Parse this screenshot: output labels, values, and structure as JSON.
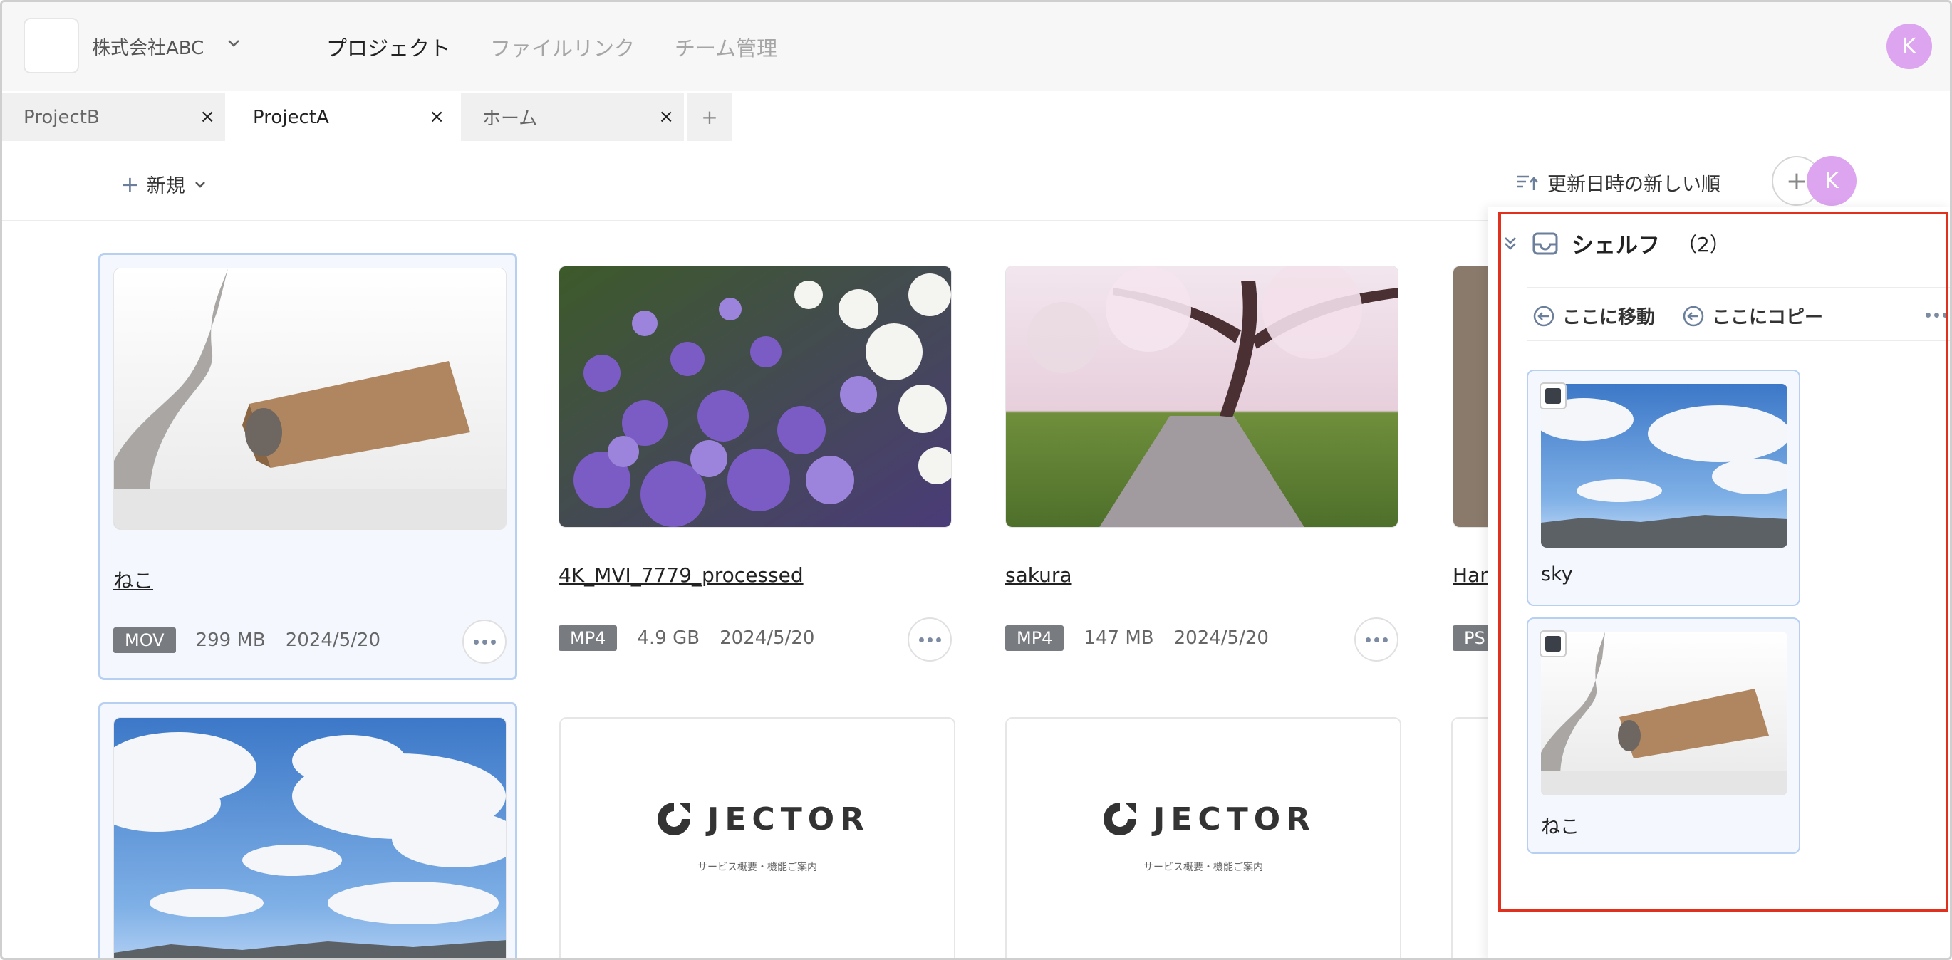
{
  "header": {
    "org_name": "株式会社ABC",
    "nav": [
      "プロジェクト",
      "ファイルリンク",
      "チーム管理"
    ],
    "avatar_initial": "K"
  },
  "tabs": [
    {
      "label": "ProjectB",
      "active": false
    },
    {
      "label": "ProjectA",
      "active": true
    },
    {
      "label": "ホーム",
      "active": false
    }
  ],
  "tab_close": "×",
  "tab_add": "+",
  "toolbar": {
    "new_label": "新規",
    "sort_label": "更新日時の新しい順",
    "add_symbol": "+",
    "avatar_initial": "K"
  },
  "files": [
    {
      "name": "ねこ",
      "type": "MOV",
      "size": "299 MB",
      "date": "2024/5/20",
      "selected": true
    },
    {
      "name": "4K_MVI_7779_processed",
      "type": "MP4",
      "size": "4.9 GB",
      "date": "2024/5/20",
      "selected": false
    },
    {
      "name": "sakura",
      "type": "MP4",
      "size": "147 MB",
      "date": "2024/5/20",
      "selected": false
    },
    {
      "name": "Han",
      "type": "PS",
      "size": "",
      "date": "",
      "selected": false
    }
  ],
  "docs": {
    "logo_text": "JECTOR",
    "subtitle": "サービス概要・機能ご案内"
  },
  "shelf": {
    "title": "シェルフ",
    "count": "（2）",
    "move_label": "ここに移動",
    "copy_label": "ここにコピー",
    "items": [
      {
        "label": "sky"
      },
      {
        "label": "ねこ"
      }
    ]
  },
  "colors": {
    "accent_border": "#b7d0f2",
    "selected_bg": "#f4f8fe",
    "avatar": "#dda4ef",
    "highlight": "#e2301f"
  }
}
